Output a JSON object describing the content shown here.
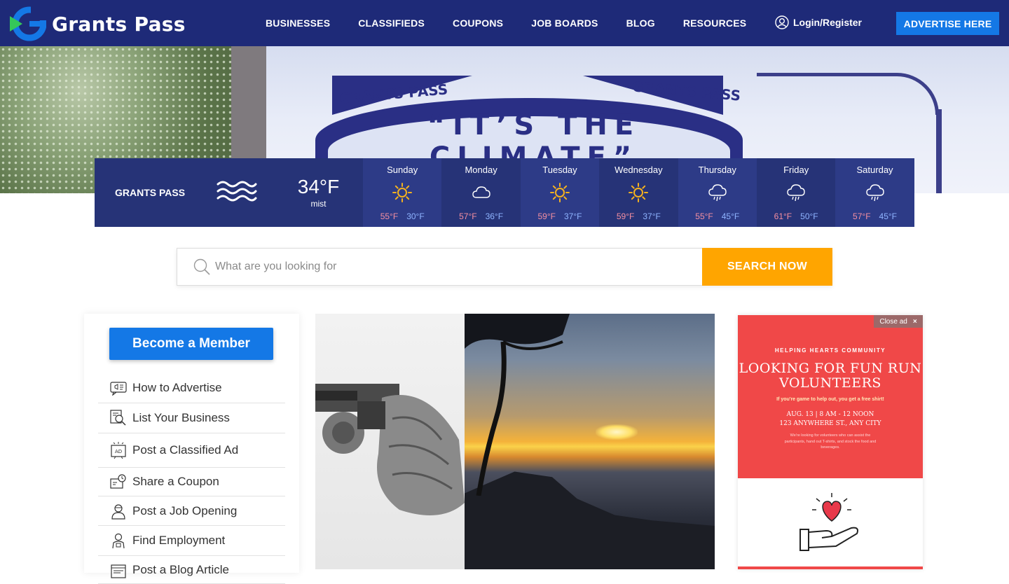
{
  "brand": {
    "name": "Grants Pass"
  },
  "nav": {
    "items": [
      "BUSINESSES",
      "CLASSIFIEDS",
      "COUPONS",
      "JOB BOARDS",
      "BLOG",
      "RESOURCES"
    ],
    "login": "Login/Register",
    "advertise": "ADVERTISE HERE"
  },
  "hero": {
    "sign_text": "“IT’S THE CLIMATE”",
    "pennant_left": "GRANTS PASS",
    "pennant_right": "GRANTS PASS"
  },
  "weather": {
    "city": "GRANTS PASS",
    "current_temp": "34°F",
    "current_desc": "mist",
    "current_icon": "mist-icon",
    "days": [
      {
        "name": "Sunday",
        "icon": "sun-icon",
        "hi": "55°F",
        "lo": "30°F"
      },
      {
        "name": "Monday",
        "icon": "cloud-icon",
        "hi": "57°F",
        "lo": "36°F"
      },
      {
        "name": "Tuesday",
        "icon": "sun-icon",
        "hi": "59°F",
        "lo": "37°F"
      },
      {
        "name": "Wednesday",
        "icon": "sun-icon",
        "hi": "59°F",
        "lo": "37°F"
      },
      {
        "name": "Thursday",
        "icon": "rain-cloud-icon",
        "hi": "55°F",
        "lo": "45°F"
      },
      {
        "name": "Friday",
        "icon": "rain-cloud-icon",
        "hi": "61°F",
        "lo": "50°F"
      },
      {
        "name": "Saturday",
        "icon": "rain-cloud-icon",
        "hi": "57°F",
        "lo": "45°F"
      }
    ],
    "colors": {
      "bg": "#263377",
      "hi": "#f48fa0",
      "lo": "#8fb4ff",
      "sun": "#f5b21e"
    }
  },
  "search": {
    "placeholder": "What are you looking for",
    "value": "",
    "button": "SEARCH NOW"
  },
  "sidebar": {
    "member_button": "Become a Member",
    "items": [
      {
        "label": "How to Advertise",
        "icon": "megaphone-icon"
      },
      {
        "label": "List Your Business",
        "icon": "business-search-icon"
      },
      {
        "label": "Post a Classified Ad",
        "icon": "ad-board-icon"
      },
      {
        "label": "Share a Coupon",
        "icon": "coupon-icon"
      },
      {
        "label": "Post a Job Opening",
        "icon": "recruiter-icon"
      },
      {
        "label": "Find Employment",
        "icon": "worker-icon"
      },
      {
        "label": "Post a Blog Article",
        "icon": "blog-icon"
      }
    ]
  },
  "ad": {
    "close_label": "Close ad",
    "organization": "HELPING HEARTS COMMUNITY",
    "title": "LOOKING FOR FUN RUN VOLUNTEERS",
    "subtitle": "If you're game to help out, you get a free shirt!",
    "when": "AUG. 13 | 8 AM - 12 NOON",
    "where": "123 ANYWHERE ST., ANY CITY",
    "description": "We're looking for volunteers who can assist the participants, hand out T-shirts, and stock the food and beverages.",
    "accent": "#f04848"
  },
  "colors": {
    "header": "#1e2a78",
    "primary_button": "#1478e6",
    "search_button": "#ffa500"
  }
}
